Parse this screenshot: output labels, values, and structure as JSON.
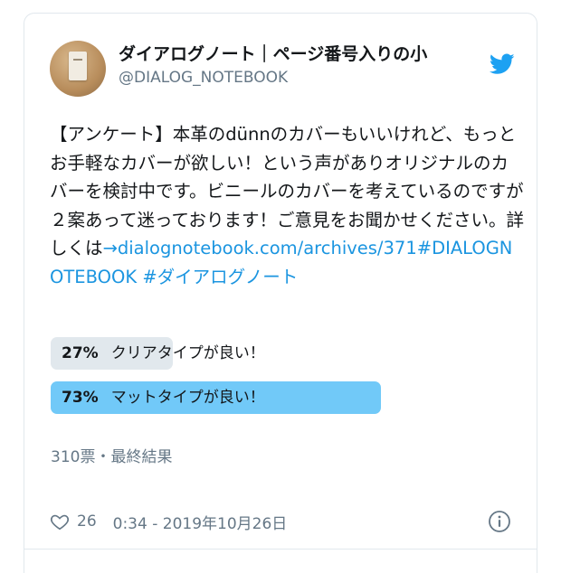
{
  "account": {
    "name": "ダイアログノート｜ページ番号入りの小",
    "handle": "@DIALOG_NOTEBOOK",
    "avatar_icon": "notebook-avatar",
    "brand_icon": "twitter-bird-icon"
  },
  "tweet": {
    "text_plain": "【アンケート】本革のdünnのカバーもいいけれど、もっとお手軽なカバーが欲しい！という声がありオリジナルのカバーを検討中です。ビニールのカバーを考えているのですが２案あって迷っております！ご意見をお聞かせください。詳しくは",
    "link": "→dialognotebook.com/archives/371",
    "hashtag1": "#DIALOGNOTEBOOK",
    "hashtag2": "#ダイアログノート"
  },
  "poll": {
    "options": [
      {
        "percent": "27%",
        "label": "クリアタイプが良い！",
        "fraction": 0.27,
        "winner": false
      },
      {
        "percent": "73%",
        "label": "マットタイプが良い！",
        "fraction": 0.73,
        "winner": true
      }
    ],
    "summary": "310票・最終結果"
  },
  "footer": {
    "likes": "26",
    "timestamp": "0:34 - 2019年10月26日",
    "info_icon": "info-icon"
  },
  "colors": {
    "accent": "#1da1f2",
    "link": "#1b95e0",
    "winner_bar": "#71c9f8",
    "loser_bar": "#e1e8ed",
    "secondary_text": "#657786"
  }
}
